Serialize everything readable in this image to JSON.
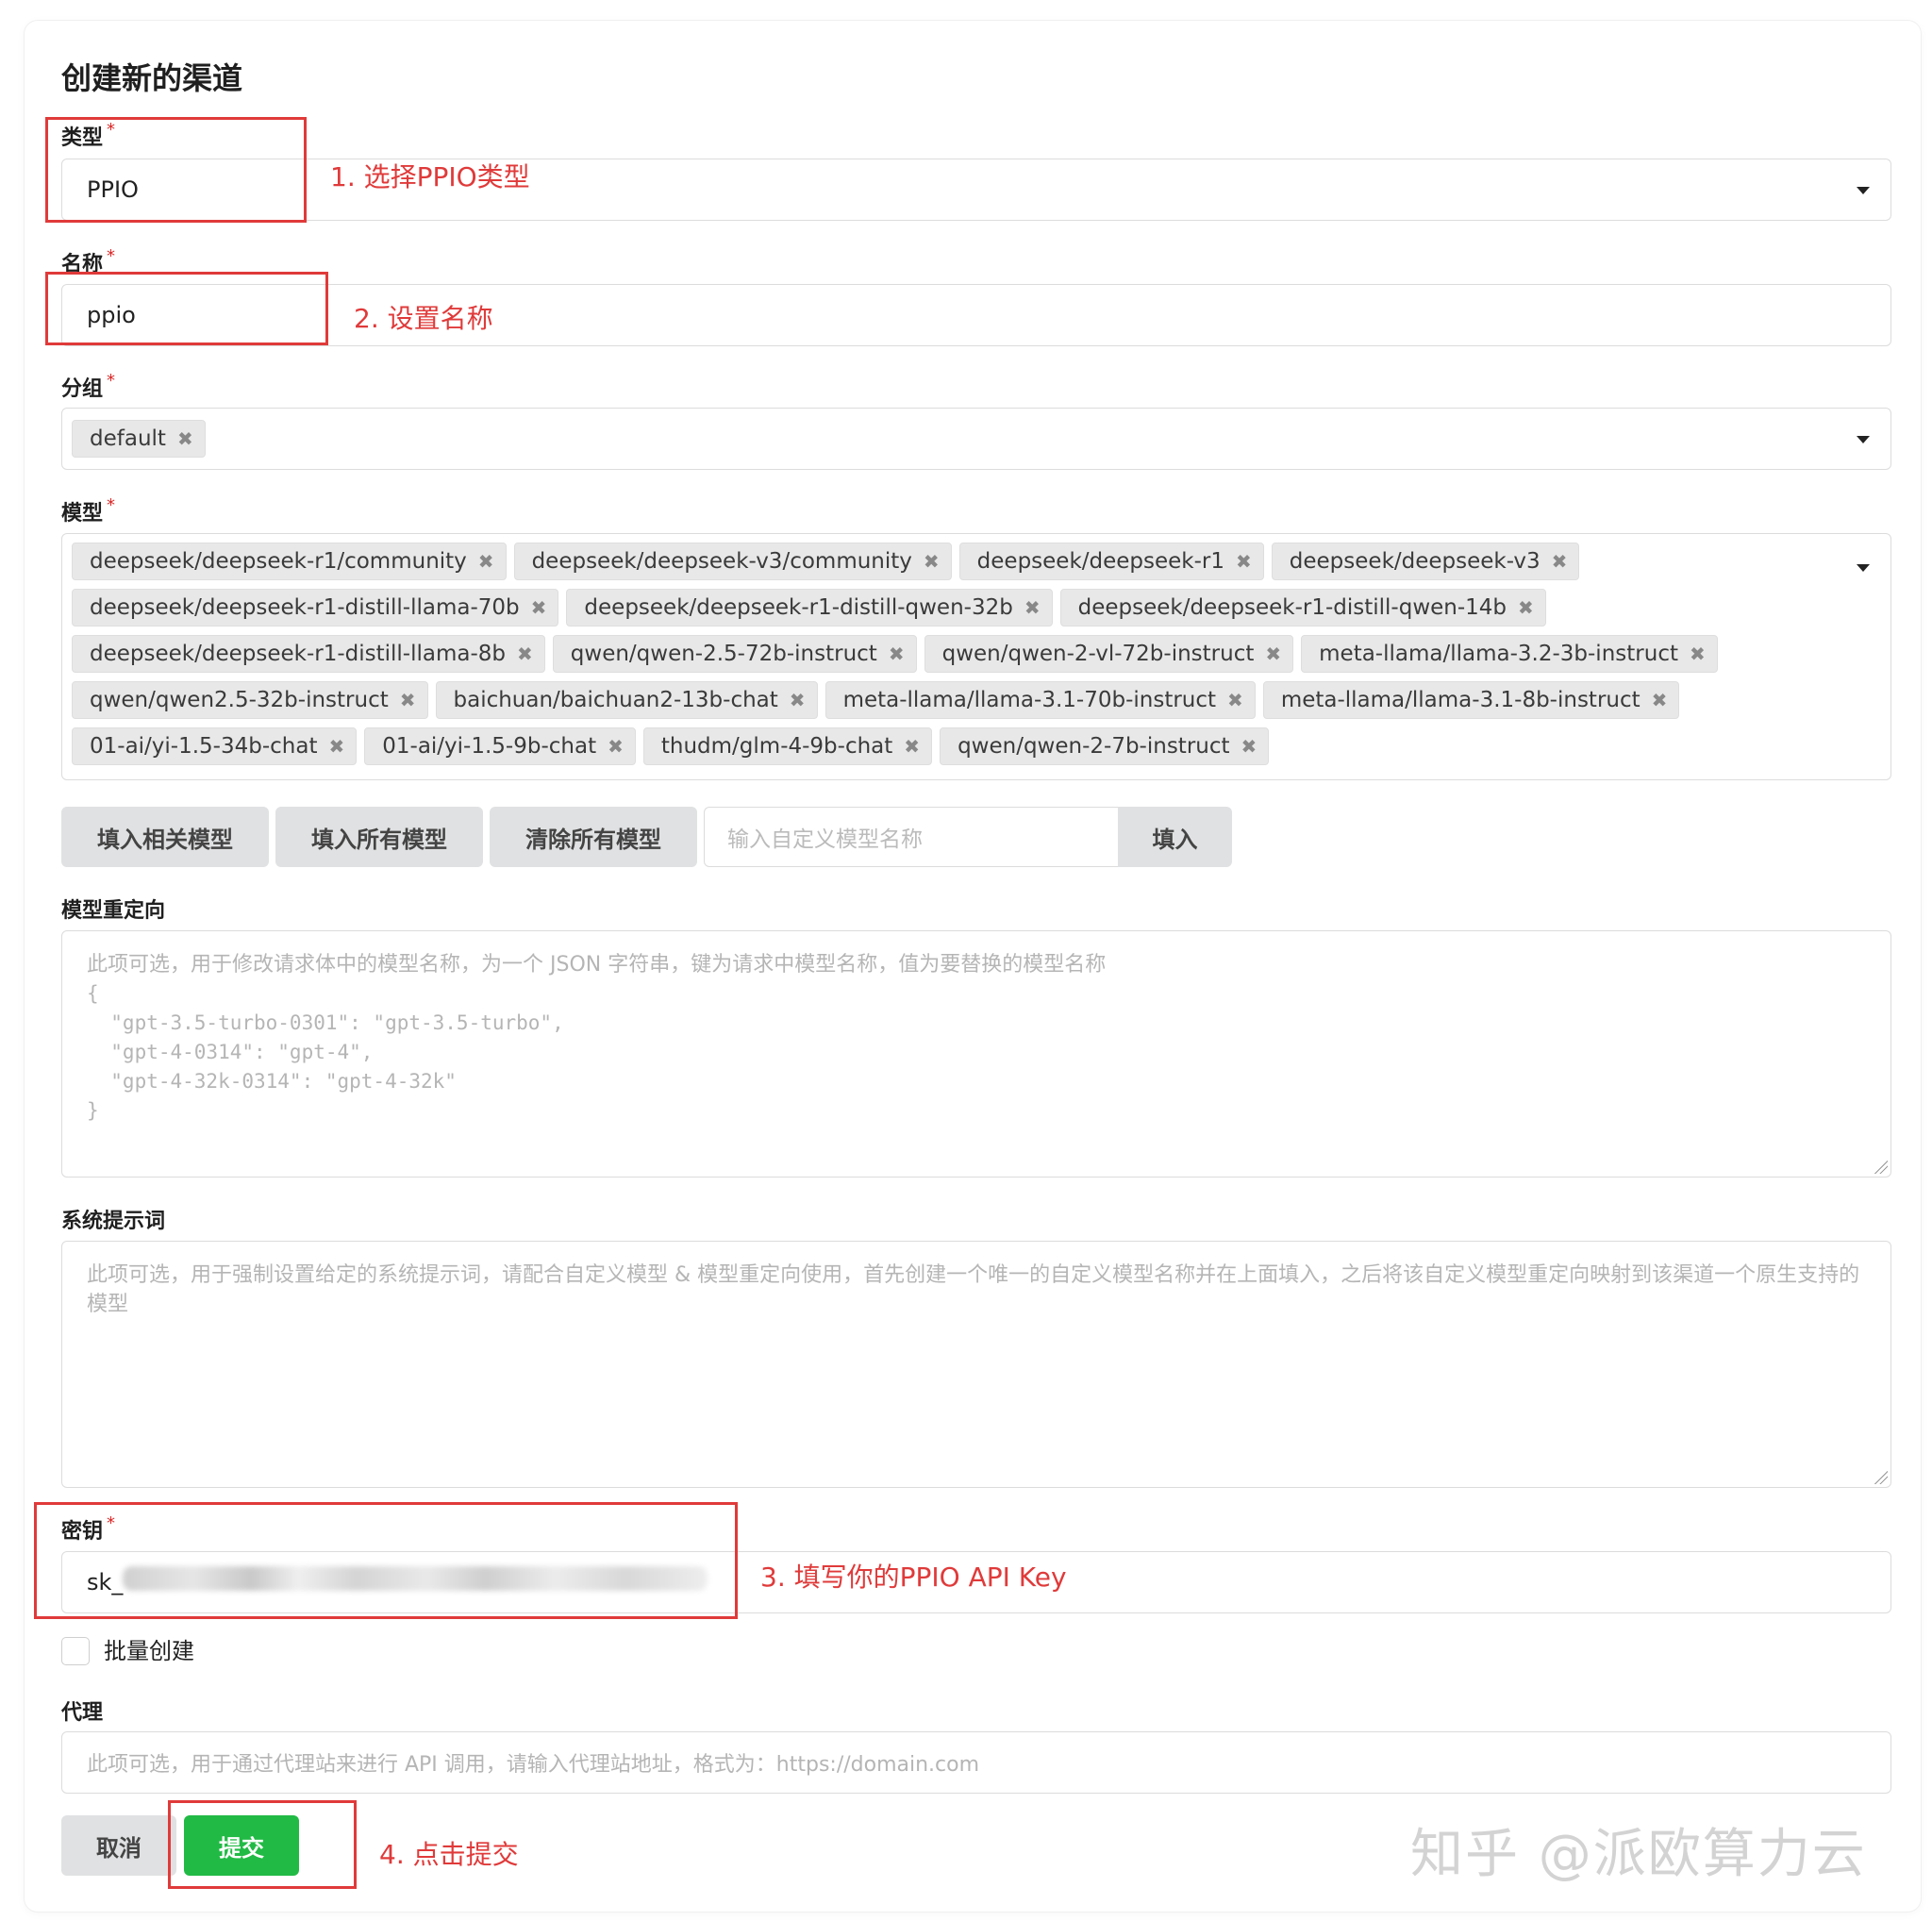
{
  "form": {
    "title": "创建新的渠道",
    "required_mark": "*",
    "type": {
      "label": "类型",
      "value": "PPIO"
    },
    "name": {
      "label": "名称",
      "value": "ppio"
    },
    "group": {
      "label": "分组",
      "chips": [
        "default"
      ]
    },
    "models": {
      "label": "模型",
      "chips": [
        "deepseek/deepseek-r1/community",
        "deepseek/deepseek-v3/community",
        "deepseek/deepseek-r1",
        "deepseek/deepseek-v3",
        "deepseek/deepseek-r1-distill-llama-70b",
        "deepseek/deepseek-r1-distill-qwen-32b",
        "deepseek/deepseek-r1-distill-qwen-14b",
        "deepseek/deepseek-r1-distill-llama-8b",
        "qwen/qwen-2.5-72b-instruct",
        "qwen/qwen-2-vl-72b-instruct",
        "meta-llama/llama-3.2-3b-instruct",
        "qwen/qwen2.5-32b-instruct",
        "baichuan/baichuan2-13b-chat",
        "meta-llama/llama-3.1-70b-instruct",
        "meta-llama/llama-3.1-8b-instruct",
        "01-ai/yi-1.5-34b-chat",
        "01-ai/yi-1.5-9b-chat",
        "thudm/glm-4-9b-chat",
        "qwen/qwen-2-7b-instruct"
      ],
      "buttons": {
        "fill_related": "填入相关模型",
        "fill_all": "填入所有模型",
        "clear_all": "清除所有模型",
        "custom_placeholder": "输入自定义模型名称",
        "fill": "填入"
      }
    },
    "model_mapping": {
      "label": "模型重定向",
      "placeholder_line1": "此项可选，用于修改请求体中的模型名称，为一个 JSON 字符串，键为请求中模型名称，值为要替换的模型名称",
      "placeholder_code": "{\n  \"gpt-3.5-turbo-0301\": \"gpt-3.5-turbo\",\n  \"gpt-4-0314\": \"gpt-4\",\n  \"gpt-4-32k-0314\": \"gpt-4-32k\"\n}"
    },
    "system_prompt": {
      "label": "系统提示词",
      "placeholder": "此项可选，用于强制设置给定的系统提示词，请配合自定义模型 & 模型重定向使用，首先创建一个唯一的自定义模型名称并在上面填入，之后将该自定义模型重定向映射到该渠道一个原生支持的模型"
    },
    "key": {
      "label": "密钥",
      "value_prefix": "sk_"
    },
    "batch": {
      "label": "批量创建"
    },
    "proxy": {
      "label": "代理",
      "placeholder": "此项可选，用于通过代理站来进行 API 调用，请输入代理站地址，格式为：https://domain.com"
    },
    "actions": {
      "cancel": "取消",
      "submit": "提交"
    }
  },
  "annotations": {
    "step1": "1. 选择PPIO类型",
    "step2": "2. 设置名称",
    "step3": "3. 填写你的PPIO API Key",
    "step4": "4. 点击提交"
  },
  "watermark": "知乎 @派欧算力云",
  "colors": {
    "annotation": "#e03a3a",
    "submit": "#21ba45",
    "required": "#db2828"
  }
}
